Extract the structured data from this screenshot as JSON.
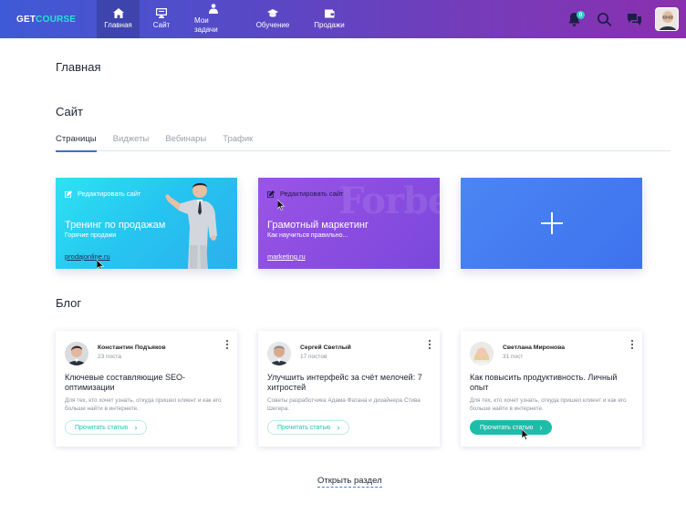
{
  "app": {
    "logo_part1": "GET",
    "logo_part2": "COURSE"
  },
  "nav": [
    {
      "label": "Главная",
      "icon": "home-icon",
      "active": true
    },
    {
      "label": "Сайт",
      "icon": "monitor-icon",
      "active": false
    },
    {
      "label": "Мои задачи",
      "icon": "tasks-icon",
      "active": false
    },
    {
      "label": "Обучение",
      "icon": "graduation-cap-icon",
      "active": false
    },
    {
      "label": "Продажи",
      "icon": "wallet-icon",
      "active": false
    }
  ],
  "header_right": {
    "notifications_count": "0",
    "icons": [
      "bell-icon",
      "search-icon",
      "chat-icon",
      "user-avatar"
    ]
  },
  "page": {
    "title": "Главная"
  },
  "site": {
    "title": "Сайт",
    "tabs": [
      "Страницы",
      "Виджеты",
      "Вебинары",
      "Трафик"
    ],
    "active_tab": "Страницы",
    "cards": [
      {
        "edit_label": "Редактировать сайт",
        "title": "Тренинг по продажам",
        "subtitle": "Горячие продажи",
        "link": "prodajonline.ru"
      },
      {
        "edit_label": "Редактировать сайт",
        "title": "Грамотный маркетинг",
        "subtitle": "Как научиться правильно...",
        "link": "marketing.ru",
        "watermark": "Forbes"
      },
      {
        "add_icon": "plus-icon"
      }
    ]
  },
  "blog": {
    "title": "Блог",
    "posts": [
      {
        "author": "Константин Подъяков",
        "posts": "23 поста",
        "title": "Ключевые составляющие SEO-оптимизации",
        "desc": "Для тех, кто хочет узнать, откуда пришел клиент и как его больше найти в интернете.",
        "button": "Прочитать статью"
      },
      {
        "author": "Сергей Светлый",
        "posts": "17 постов",
        "title": "Улучшить интерфейс за счёт мелочей: 7 хитростей",
        "desc": "Советы разработчика Адама Фатана и дизайнера Стива Шегера.",
        "button": "Прочитать статью"
      },
      {
        "author": "Светлана Миронова",
        "posts": "31 пост",
        "title": "Как повысить продуктивность. Личный опыт",
        "desc": "Для тех, кто хочет узнать, откуда пришел клиент и как его больше найти в интернете.",
        "button": "Прочитать статью"
      }
    ],
    "open_section": "Открыть раздел"
  },
  "colors": {
    "accent_teal": "#1ebda9",
    "header_start": "#3f5ad6",
    "header_end": "#8a2fae",
    "tab_underline": "#3b6fd6"
  }
}
